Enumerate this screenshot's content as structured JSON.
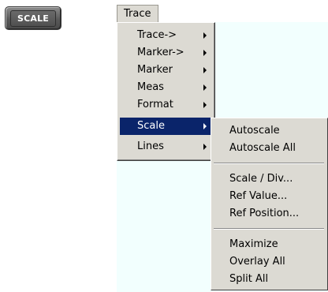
{
  "hardkey": {
    "label": "SCALE"
  },
  "menubar": {
    "trace_label": "Trace"
  },
  "trace_menu": {
    "items": [
      {
        "label": "Trace->"
      },
      {
        "label": "Marker->"
      },
      {
        "label": "Marker"
      },
      {
        "label": "Meas"
      },
      {
        "label": "Format"
      },
      {
        "label": "Scale"
      },
      {
        "label": "Lines"
      }
    ],
    "active_index": 5
  },
  "scale_submenu": {
    "groups": [
      [
        {
          "label": "Autoscale"
        },
        {
          "label": "Autoscale All"
        }
      ],
      [
        {
          "label": "Scale / Div..."
        },
        {
          "label": "Ref Value..."
        },
        {
          "label": "Ref Position..."
        }
      ],
      [
        {
          "label": "Maximize"
        },
        {
          "label": "Overlay All"
        },
        {
          "label": "Split All"
        }
      ]
    ]
  },
  "colors": {
    "menu_bg": "#dcdad3",
    "highlight": "#0a246a",
    "area_bg": "#f2fffe"
  }
}
